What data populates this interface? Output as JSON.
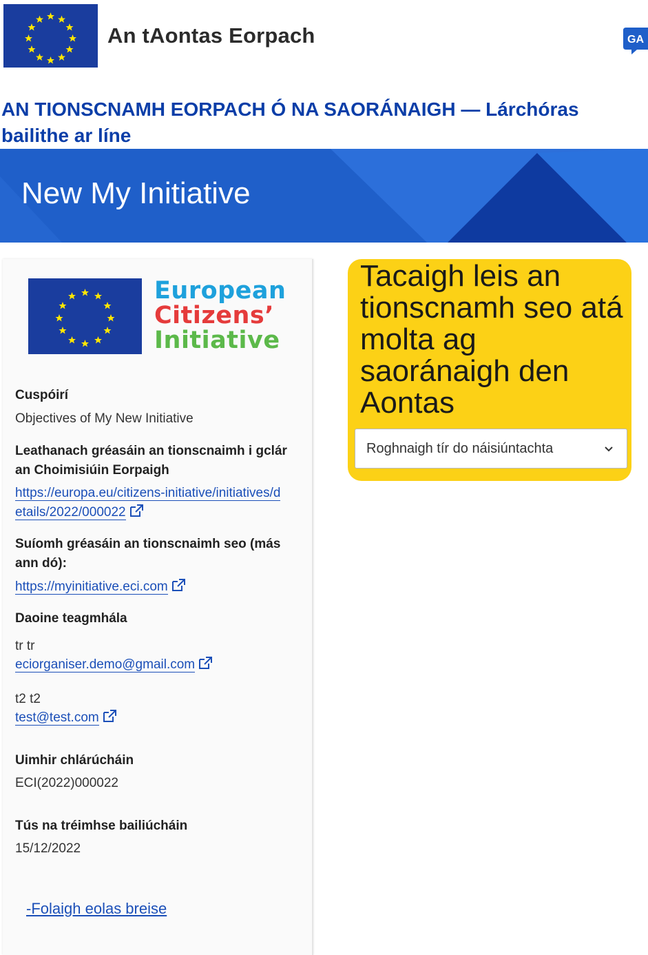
{
  "header": {
    "site_name": "An tAontas Eorpach",
    "language_code": "GA",
    "logo_icon": "eu-flag-icon"
  },
  "page_title": "AN TIONSCNAMH EORPACH Ó NA SAORÁNAIGH — Lárchóras bailithe ar líne",
  "banner": {
    "title": "New My Initiative"
  },
  "info": {
    "logo_words": [
      "European",
      "Citizens’",
      "Initiative"
    ],
    "objectives_label": "Cuspóirí",
    "objectives_value": "Objectives of My New Initiative",
    "register_page_label": "Leathanach gréasáin an tionscnaimh i gclár an Choimisiúin Eorpaigh",
    "register_page_link": "https://europa.eu/citizens-initiative/initiatives/details/2022/000022",
    "website_label": "Suíomh gréasáin an tionscnaimh seo (más ann dó):",
    "website_link": "https://myinitiative.eci.com",
    "contacts_label": "Daoine teagmhála",
    "contacts": [
      {
        "name": "tr tr",
        "email": "eciorganiser.demo@gmail.com"
      },
      {
        "name": "t2 t2",
        "email": "test@test.com"
      }
    ],
    "registration_label": "Uimhir chlárúcháin",
    "registration_value": "ECI(2022)000022",
    "collection_start_label": "Tús na tréimhse bailiúcháin",
    "collection_start_value": "15/12/2022",
    "toggle_link": "-Folaigh eolas breise"
  },
  "support": {
    "text": "Tacaigh leis an tionscnamh seo atá molta ag saoránaigh den Aontas",
    "select_placeholder": "Roghnaigh tír do náisiúntachta"
  },
  "colors": {
    "primary_blue": "#0b3ea8",
    "banner_blue": "#1f5fc9",
    "support_yellow": "#fcd116",
    "link_blue": "#1b4fb8"
  }
}
